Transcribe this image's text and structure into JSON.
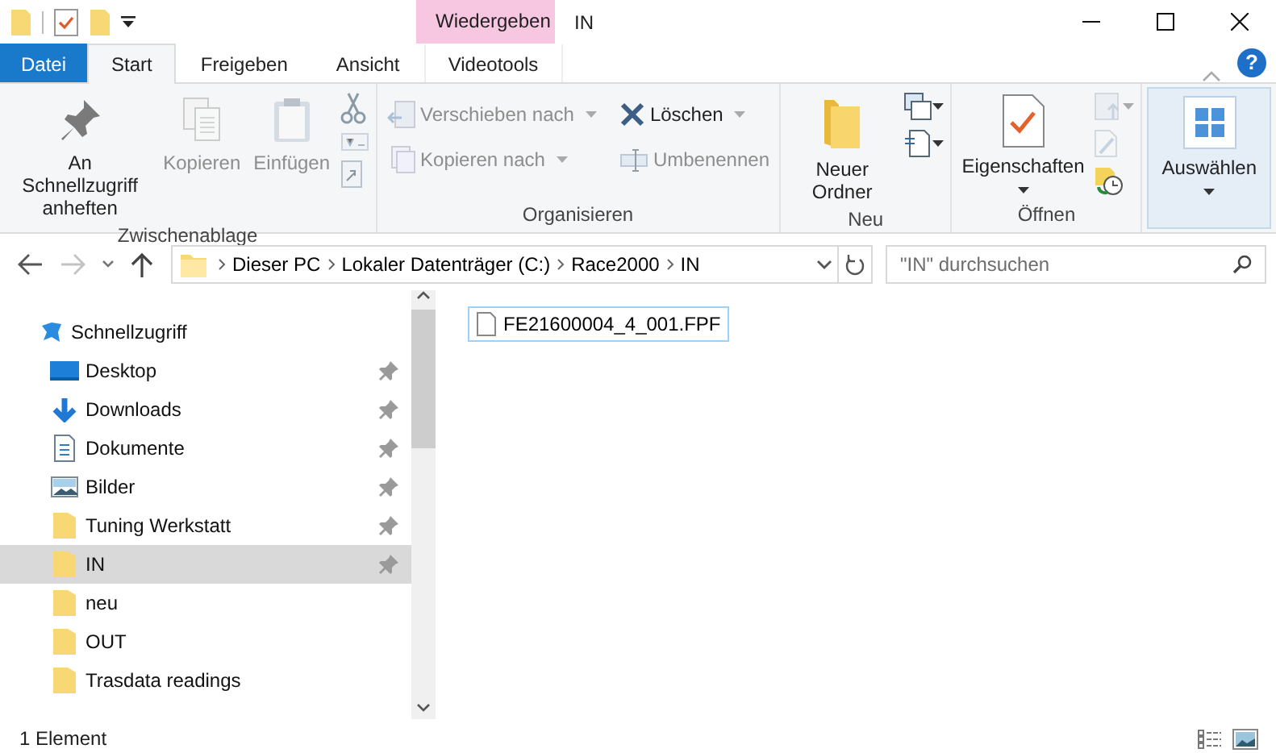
{
  "window": {
    "title": "IN",
    "contextual_header": "Wiedergeben"
  },
  "tabs": [
    {
      "label": "Datei",
      "kind": "file",
      "selected": false
    },
    {
      "label": "Start",
      "kind": "tab",
      "selected": true
    },
    {
      "label": "Freigeben",
      "kind": "tab",
      "selected": false
    },
    {
      "label": "Ansicht",
      "kind": "tab",
      "selected": false
    },
    {
      "label": "Videotools",
      "kind": "contextual",
      "selected": false
    }
  ],
  "ribbon": {
    "groups": [
      {
        "label": "Zwischenablage",
        "columns": [
          [
            {
              "kind": "large",
              "label": "An Schnellzugriff anheften",
              "disabled": false,
              "dropdown": false
            }
          ],
          [
            {
              "kind": "large",
              "label": "Kopieren",
              "disabled": true,
              "dropdown": false
            }
          ],
          [
            {
              "kind": "large",
              "label": "Einfügen",
              "disabled": true,
              "dropdown": false
            }
          ],
          [
            {
              "kind": "tool",
              "disabled": false,
              "dropdown": false
            },
            {
              "kind": "tool",
              "disabled": true,
              "dropdown": false
            },
            {
              "kind": "tool",
              "disabled": true,
              "dropdown": false
            }
          ]
        ]
      },
      {
        "label": "Organisieren",
        "columns": [
          [
            {
              "kind": "small",
              "label": "Verschieben nach",
              "disabled": true,
              "dropdown": true
            },
            {
              "kind": "small",
              "label": "Kopieren nach",
              "disabled": true,
              "dropdown": true
            }
          ],
          [
            {
              "kind": "small",
              "label": "Löschen",
              "disabled": false,
              "dropdown": true
            },
            {
              "kind": "small",
              "label": "Umbenennen",
              "disabled": true,
              "dropdown": false
            }
          ]
        ]
      },
      {
        "label": "Neu",
        "columns": [
          [
            {
              "kind": "large",
              "label": "Neuer Ordner",
              "disabled": false,
              "dropdown": false
            }
          ],
          [
            {
              "kind": "tool",
              "disabled": false,
              "dropdown": true
            },
            {
              "kind": "tool",
              "disabled": false,
              "dropdown": true
            }
          ]
        ]
      },
      {
        "label": "Öffnen",
        "columns": [
          [
            {
              "kind": "large",
              "label": "Eigenschaften",
              "disabled": false,
              "dropdown": true
            }
          ],
          [
            {
              "kind": "tool",
              "disabled": true,
              "dropdown": true
            },
            {
              "kind": "tool",
              "disabled": true,
              "dropdown": false
            },
            {
              "kind": "tool",
              "disabled": false,
              "dropdown": false
            }
          ]
        ]
      },
      {
        "columns": [
          [
            {
              "kind": "large",
              "label": "Auswählen",
              "disabled": false,
              "dropdown": true,
              "selected": true
            }
          ]
        ]
      }
    ]
  },
  "address": {
    "segments": [
      "Dieser PC",
      "Lokaler Datenträger (C:)",
      "Race2000",
      "IN"
    ],
    "forward_disabled": true
  },
  "search": {
    "placeholder": "\"IN\" durchsuchen"
  },
  "help": {
    "label": "?"
  },
  "sidebar": {
    "items": [
      {
        "label": "Schnellzugriff",
        "selected": false,
        "children": [
          {
            "label": "Desktop",
            "selected": false,
            "pinned": true
          },
          {
            "label": "Downloads",
            "selected": false,
            "pinned": true
          },
          {
            "label": "Dokumente",
            "selected": false,
            "pinned": true
          },
          {
            "label": "Bilder",
            "selected": false,
            "pinned": true
          },
          {
            "label": "Tuning Werkstatt",
            "selected": false,
            "pinned": true
          },
          {
            "label": "IN",
            "selected": true,
            "pinned": true
          },
          {
            "label": "neu",
            "selected": false,
            "pinned": false
          },
          {
            "label": "OUT",
            "selected": false,
            "pinned": false
          },
          {
            "label": "Trasdata readings",
            "selected": false,
            "pinned": false
          }
        ]
      }
    ]
  },
  "files": [
    {
      "name": "FE21600004_4_001.FPF",
      "selected": true
    }
  ],
  "status_bar": {
    "count": "1 Element"
  }
}
